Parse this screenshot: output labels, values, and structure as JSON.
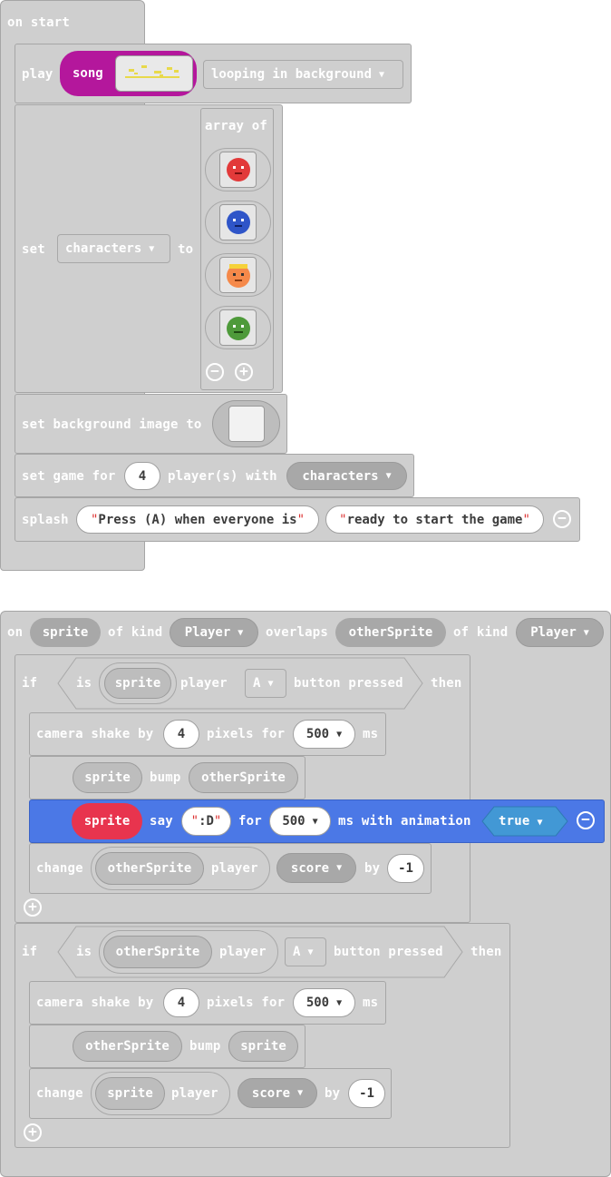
{
  "on_start": {
    "hat_label": "on start",
    "play": {
      "label": "play",
      "song_label": "song",
      "mode": "looping in background"
    },
    "set_characters": {
      "set_label": "set",
      "variable": "characters",
      "to_label": "to",
      "array_label": "array of",
      "sprites": [
        "red-character-sprite",
        "blue-character-sprite",
        "orange-character-sprite",
        "green-character-sprite"
      ]
    },
    "background": {
      "label": "set background image to"
    },
    "set_game": {
      "label": "set game for",
      "count": "4",
      "players_label": "player(s) with",
      "variable": "characters"
    },
    "splash": {
      "label": "splash",
      "line1": "Press (A) when everyone is",
      "line2": "ready to start the game"
    }
  },
  "overlap": {
    "on_label": "on",
    "sprite": "sprite",
    "of_kind": "of kind",
    "kind1": "Player",
    "overlaps_label": "overlaps",
    "other": "otherSprite",
    "of_kind2": "of kind",
    "kind2": "Player",
    "if1": {
      "if_label": "if",
      "is_label": "is",
      "sprite": "sprite",
      "player_label": "player",
      "button": "A",
      "pressed_label": "button pressed",
      "then_label": "then",
      "shake": {
        "label": "camera shake by",
        "amount": "4",
        "pixels_for": "pixels for",
        "ms_value": "500",
        "ms": "ms"
      },
      "bump": {
        "a": "sprite",
        "label": "bump",
        "b": "otherSprite"
      },
      "say": {
        "sprite": "sprite",
        "say_label": "say",
        "text": ":D",
        "for_label": "for",
        "ms_value": "500",
        "with_label": "ms with animation",
        "anim": "true"
      },
      "change": {
        "label": "change",
        "sprite": "otherSprite",
        "player_label": "player",
        "field": "score",
        "by_label": "by",
        "amount": "-1"
      }
    },
    "if2": {
      "if_label": "if",
      "is_label": "is",
      "sprite": "otherSprite",
      "player_label": "player",
      "button": "A",
      "pressed_label": "button pressed",
      "then_label": "then",
      "shake": {
        "label": "camera shake by",
        "amount": "4",
        "pixels_for": "pixels for",
        "ms_value": "500",
        "ms": "ms"
      },
      "bump": {
        "a": "otherSprite",
        "label": "bump",
        "b": "sprite"
      },
      "change": {
        "label": "change",
        "sprite": "sprite",
        "player_label": "player",
        "field": "score",
        "by_label": "by",
        "amount": "-1"
      }
    }
  },
  "colors": {
    "block": "#cfcfcf",
    "say_block": "#4b78e6",
    "song_pill": "#b4179c",
    "sprite_pill": "#e8344e",
    "true_hex": "#4298d5"
  }
}
